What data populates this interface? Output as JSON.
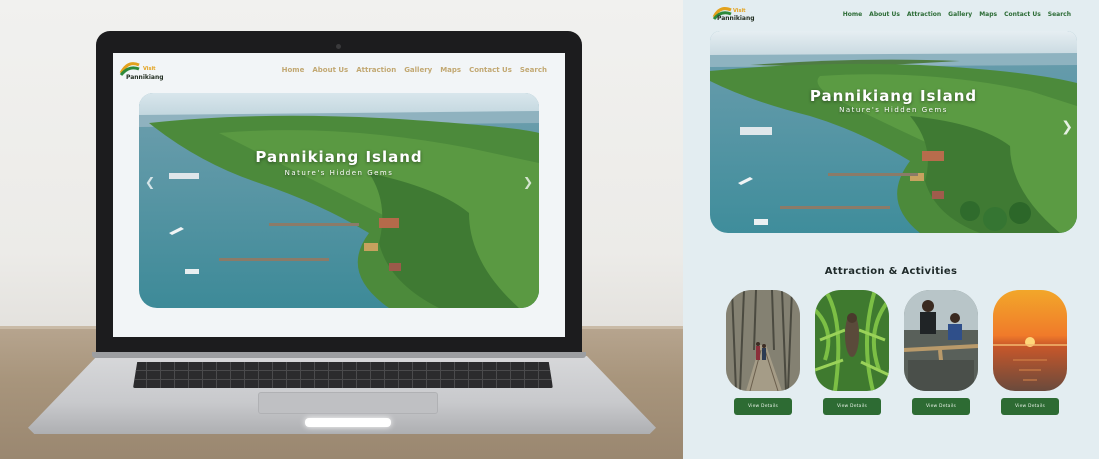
{
  "site": {
    "logo": {
      "name": "Pannikiang",
      "tagline": "Visit"
    },
    "nav": [
      {
        "label": "Home"
      },
      {
        "label": "About Us"
      },
      {
        "label": "Attraction"
      },
      {
        "label": "Gallery"
      },
      {
        "label": "Maps"
      },
      {
        "label": "Contact Us"
      },
      {
        "label": "Search"
      }
    ],
    "hero": {
      "title": "Pannikiang Island",
      "subtitle": "Nature's Hidden Gems"
    },
    "section": {
      "title": "Attraction & Activities"
    },
    "cards": [
      {
        "image": "mangrove-boardwalk-photo",
        "button": "View Details"
      },
      {
        "image": "bat-in-tree-photo",
        "button": "View Details"
      },
      {
        "image": "family-on-pier-photo",
        "button": "View Details"
      },
      {
        "image": "sunset-sea-photo",
        "button": "View Details"
      }
    ]
  },
  "colors": {
    "brand_green": "#2d6b33",
    "nav_text": "#2b6b35",
    "page_bg": "#e3edf1",
    "logo_gold": "#e3a21d"
  },
  "icons": {
    "next": "chevron-right-icon",
    "prev": "chevron-left-icon"
  }
}
